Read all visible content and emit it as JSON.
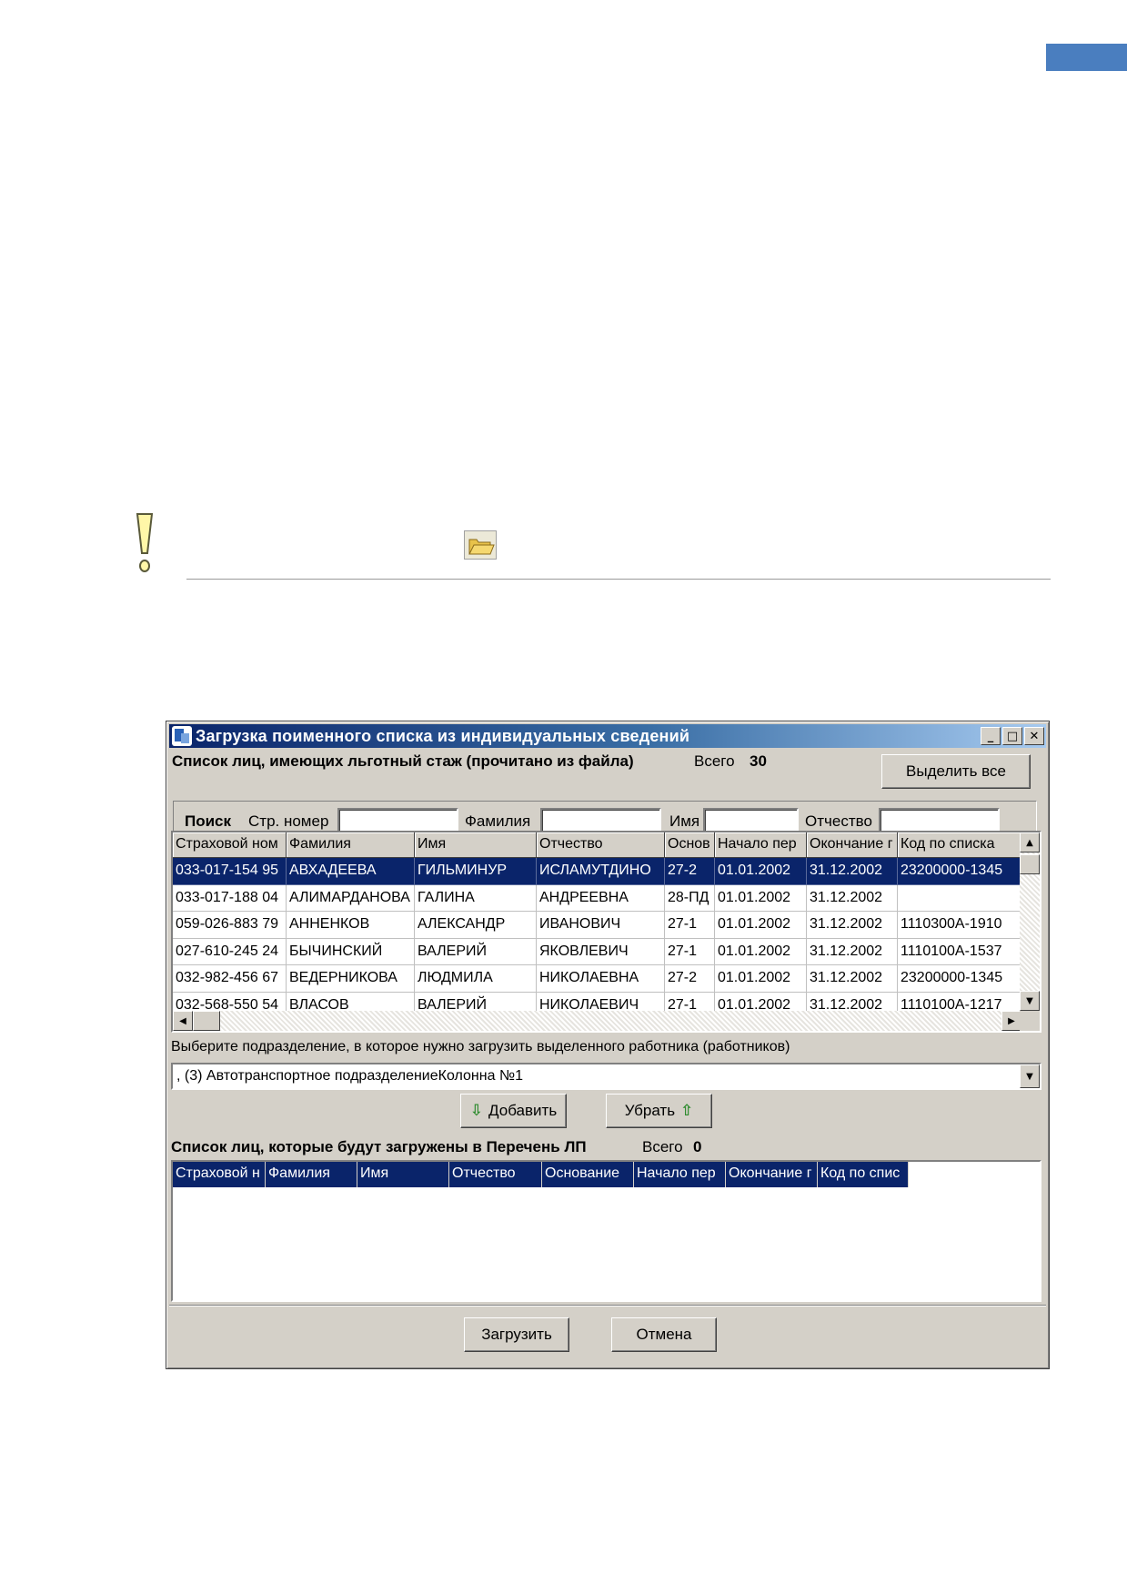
{
  "dialog": {
    "title": "Загрузка поименного списка из индивидуальных сведений",
    "list_heading": "Список лиц, имеющих льготный стаж (прочитано из файла)",
    "total_label": "Всего",
    "total_value": "30",
    "select_all_label": "Выделить все",
    "search": {
      "heading": "Поиск",
      "ins_number_label": "Стр. номер",
      "ins_number_value": "",
      "last_name_label": "Фамилия",
      "last_name_value": "",
      "first_name_label": "Имя",
      "first_name_value": "",
      "patronymic_label": "Отчество",
      "patronymic_value": ""
    },
    "grid1": {
      "columns": [
        "Страховой ном",
        "Фамилия",
        "Имя",
        "Отчество",
        "Основ",
        "Начало пер",
        "Окончание г",
        "Код по списка"
      ],
      "rows": [
        [
          "033-017-154 95",
          "АВХАДЕЕВА",
          "ГИЛЬМИНУР",
          "ИСЛАМУТДИНО",
          "27-2",
          "01.01.2002",
          "31.12.2002",
          "23200000-1345"
        ],
        [
          "033-017-188 04",
          "АЛИМАРДАНОВА",
          "ГАЛИНА",
          "АНДРЕЕВНА",
          "28-ПД",
          "01.01.2002",
          "31.12.2002",
          ""
        ],
        [
          "059-026-883 79",
          "АННЕНКОВ",
          "АЛЕКСАНДР",
          "ИВАНОВИЧ",
          "27-1",
          "01.01.2002",
          "31.12.2002",
          "1110300А-1910"
        ],
        [
          "027-610-245 24",
          "БЫЧИНСКИЙ",
          "ВАЛЕРИЙ",
          "ЯКОВЛЕВИЧ",
          "27-1",
          "01.01.2002",
          "31.12.2002",
          "1110100А-1537"
        ],
        [
          "032-982-456 67",
          "ВЕДЕРНИКОВА",
          "ЛЮДМИЛА",
          "НИКОЛАЕВНА",
          "27-2",
          "01.01.2002",
          "31.12.2002",
          "23200000-1345"
        ],
        [
          "032-568-550 54",
          "ВЛАСОВ",
          "ВАЛЕРИЙ",
          "НИКОЛАЕВИЧ",
          "27-1",
          "01.01.2002",
          "31.12.2002",
          "1110100А-1217"
        ]
      ],
      "selected_row": 0
    },
    "dept_prompt": "Выберите подразделение, в которое нужно загрузить выделенного работника (работников)",
    "dept_value": ", (3) Автотранспортное подразделениеКолонна №1",
    "add_label": "Добавить",
    "remove_label": "Убрать",
    "list2_heading": "Список лиц, которые будут загружены в Перечень ЛП",
    "total2_label": "Всего",
    "total2_value": "0",
    "grid2": {
      "columns": [
        "Страховой н",
        "Фамилия",
        "Имя",
        "Отчество",
        "Основание",
        "Начало пер",
        "Окончание г",
        "Код по спис"
      ]
    },
    "load_label": "Загрузить",
    "cancel_label": "Отмена"
  },
  "colors": {
    "accent": "#4a7ebf",
    "selection": "#0a246a",
    "window_face": "#d4d0c8"
  },
  "icons": [
    "warning-exclamation-icon",
    "open-folder-icon",
    "app-icon",
    "minimize-icon",
    "maximize-icon",
    "close-icon",
    "arrow-down-icon",
    "arrow-up-icon",
    "scroll-up-icon",
    "scroll-down-icon",
    "scroll-left-icon",
    "scroll-right-icon",
    "dropdown-arrow-icon"
  ]
}
